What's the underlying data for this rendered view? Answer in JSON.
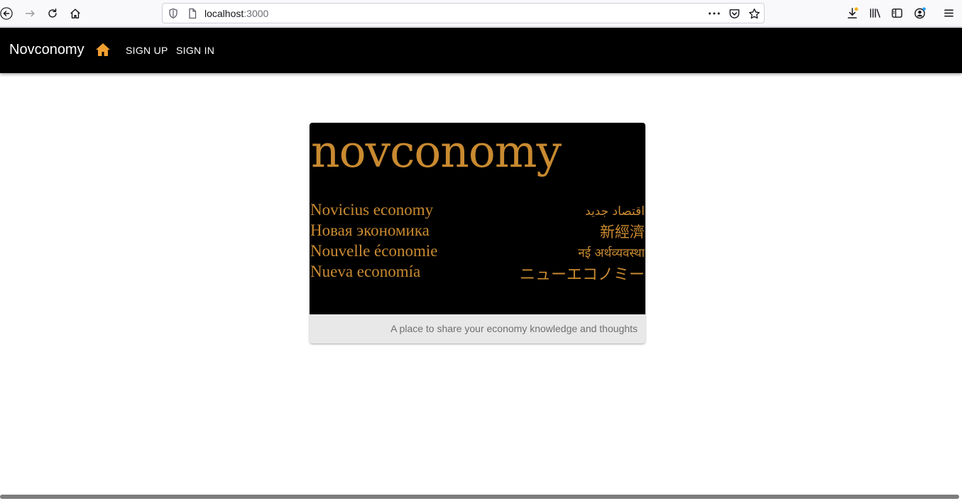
{
  "browser": {
    "url_host": "localhost",
    "url_port": ":3000",
    "icons": [
      "back-icon",
      "forward-icon",
      "reload-icon",
      "home-icon",
      "shield-icon",
      "page-icon",
      "more-icon",
      "pocket-icon",
      "star-icon",
      "download-icon",
      "library-icon",
      "sidebar-icon",
      "account-icon",
      "menu-icon"
    ]
  },
  "appbar": {
    "brand": "Novconomy",
    "home_icon_color": "#f0a030",
    "links": {
      "signup": "SIGN UP",
      "signin": "SIGN IN"
    }
  },
  "card": {
    "logo_word": "novconomy",
    "accent_color": "#c98a30",
    "languages_left": [
      "Novicius economy",
      "Новая экономика",
      "Nouvelle économie",
      "Nueva economía"
    ],
    "languages_right": [
      "اقتصاد جديد",
      "新經濟",
      "नई अर्थव्यवस्था",
      "ニューエコノミー"
    ],
    "caption": "A place to share your economy knowledge and thoughts"
  }
}
